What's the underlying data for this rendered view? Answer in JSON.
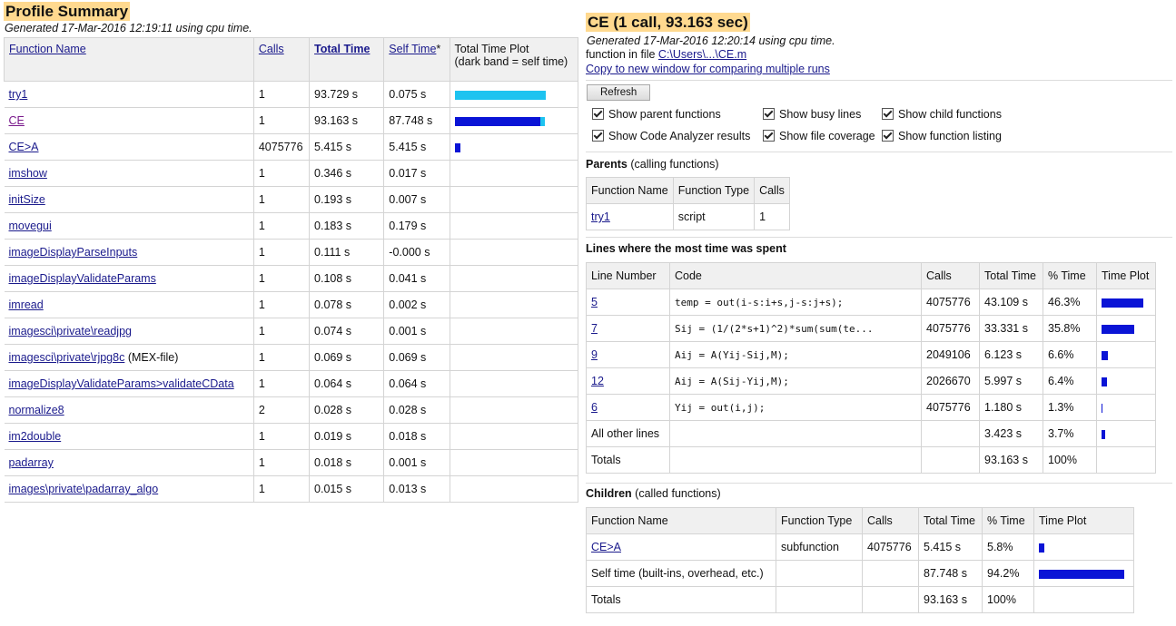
{
  "summary": {
    "title": "Profile Summary",
    "generated": "Generated 17-Mar-2016 12:19:11 using cpu time.",
    "headers": {
      "function_name": "Function Name",
      "calls": "Calls",
      "total_time": "Total Time",
      "self_time": "Self Time",
      "self_time_mark": "*",
      "plot_line1": "Total Time Plot",
      "plot_line2": "(dark band = self time)"
    },
    "rows": [
      {
        "name": "try1",
        "suffix": "",
        "calls": "1",
        "total": "93.729 s",
        "self": "0.075 s",
        "total_frac": 1.0,
        "self_frac": 0.0008
      },
      {
        "name": "CE",
        "suffix": "",
        "calls": "1",
        "total": "93.163 s",
        "self": "87.748 s",
        "total_frac": 0.994,
        "self_frac": 0.936
      },
      {
        "name": "CE>A",
        "suffix": "",
        "calls": "4075776",
        "total": "5.415 s",
        "self": "5.415 s",
        "total_frac": 0.058,
        "self_frac": 0.058
      },
      {
        "name": "imshow",
        "suffix": "",
        "calls": "1",
        "total": "0.346 s",
        "self": "0.017 s",
        "total_frac": 0.0037,
        "self_frac": 0.0002
      },
      {
        "name": "initSize",
        "suffix": "",
        "calls": "1",
        "total": "0.193 s",
        "self": "0.007 s",
        "total_frac": 0.0021,
        "self_frac": 0.0001
      },
      {
        "name": "movegui",
        "suffix": "",
        "calls": "1",
        "total": "0.183 s",
        "self": "0.179 s",
        "total_frac": 0.002,
        "self_frac": 0.0019
      },
      {
        "name": "imageDisplayParseInputs",
        "suffix": "",
        "calls": "1",
        "total": "0.111 s",
        "self": "-0.000 s",
        "total_frac": 0.0012,
        "self_frac": 0
      },
      {
        "name": "imageDisplayValidateParams",
        "suffix": "",
        "calls": "1",
        "total": "0.108 s",
        "self": "0.041 s",
        "total_frac": 0.0012,
        "self_frac": 0.0004
      },
      {
        "name": "imread",
        "suffix": "",
        "calls": "1",
        "total": "0.078 s",
        "self": "0.002 s",
        "total_frac": 0.0008,
        "self_frac": 0
      },
      {
        "name": "imagesci\\private\\readjpg",
        "suffix": "",
        "calls": "1",
        "total": "0.074 s",
        "self": "0.001 s",
        "total_frac": 0.0008,
        "self_frac": 0
      },
      {
        "name": "imagesci\\private\\rjpg8c",
        "suffix": " (MEX-file)",
        "calls": "1",
        "total": "0.069 s",
        "self": "0.069 s",
        "total_frac": 0.0007,
        "self_frac": 0.0007
      },
      {
        "name": "imageDisplayValidateParams>validateCData",
        "suffix": "",
        "calls": "1",
        "total": "0.064 s",
        "self": "0.064 s",
        "total_frac": 0.0007,
        "self_frac": 0.0007
      },
      {
        "name": "normalize8",
        "suffix": "",
        "calls": "2",
        "total": "0.028 s",
        "self": "0.028 s",
        "total_frac": 0.0003,
        "self_frac": 0.0003
      },
      {
        "name": "im2double",
        "suffix": "",
        "calls": "1",
        "total": "0.019 s",
        "self": "0.018 s",
        "total_frac": 0.0002,
        "self_frac": 0.0002
      },
      {
        "name": "padarray",
        "suffix": "",
        "calls": "1",
        "total": "0.018 s",
        "self": "0.001 s",
        "total_frac": 0.0002,
        "self_frac": 0
      },
      {
        "name": "images\\private\\padarray_algo",
        "suffix": "",
        "calls": "1",
        "total": "0.015 s",
        "self": "0.013 s",
        "total_frac": 0.0002,
        "self_frac": 0.0001
      }
    ]
  },
  "detail": {
    "title": "CE (1 call, 93.163 sec)",
    "generated": "Generated 17-Mar-2016 12:20:14 using cpu time.",
    "file_prefix": "function in file ",
    "file_path": "C:\\Users\\...\\CE.m",
    "copy_link": "Copy to new window for comparing multiple runs",
    "refresh_label": "Refresh",
    "options": [
      {
        "label": "Show parent functions",
        "checked": true
      },
      {
        "label": "Show busy lines",
        "checked": true
      },
      {
        "label": "Show child functions",
        "checked": true
      },
      {
        "label": "Show Code Analyzer results",
        "checked": true
      },
      {
        "label": "Show file coverage",
        "checked": true
      },
      {
        "label": "Show function listing",
        "checked": true
      }
    ],
    "parents": {
      "heading_bold": "Parents",
      "heading_rest": " (calling functions)",
      "headers": [
        "Function Name",
        "Function Type",
        "Calls"
      ],
      "rows": [
        {
          "name": "try1",
          "type": "script",
          "calls": "1"
        }
      ]
    },
    "lines": {
      "heading": "Lines where the most time was spent",
      "headers": [
        "Line Number",
        "Code",
        "Calls",
        "Total Time",
        "% Time",
        "Time Plot"
      ],
      "rows": [
        {
          "line": "5",
          "code": "temp = out(i-s:i+s,j-s:j+s);",
          "calls": "4075776",
          "total": "43.109 s",
          "pct": "46.3%",
          "frac": 0.463
        },
        {
          "line": "7",
          "code": "Sij = (1/(2*s+1)^2)*sum(sum(te...",
          "calls": "4075776",
          "total": "33.331 s",
          "pct": "35.8%",
          "frac": 0.358
        },
        {
          "line": "9",
          "code": "Aij = A(Yij-Sij,M);",
          "calls": "2049106",
          "total": "6.123 s",
          "pct": "6.6%",
          "frac": 0.066
        },
        {
          "line": "12",
          "code": "Aij = A(Sij-Yij,M);",
          "calls": "2026670",
          "total": "5.997 s",
          "pct": "6.4%",
          "frac": 0.064
        },
        {
          "line": "6",
          "code": "Yij = out(i,j);",
          "calls": "4075776",
          "total": "1.180 s",
          "pct": "1.3%",
          "frac": 0.013
        },
        {
          "line": "",
          "code": "",
          "label": "All other lines",
          "calls": "",
          "total": "3.423 s",
          "pct": "3.7%",
          "frac": 0.037
        }
      ],
      "totals": {
        "label": "Totals",
        "total": "93.163 s",
        "pct": "100%"
      }
    },
    "children": {
      "heading_bold": "Children",
      "heading_rest": " (called functions)",
      "headers": [
        "Function Name",
        "Function Type",
        "Calls",
        "Total Time",
        "% Time",
        "Time Plot"
      ],
      "rows": [
        {
          "name": "CE>A",
          "link": true,
          "type": "subfunction",
          "calls": "4075776",
          "total": "5.415 s",
          "pct": "5.8%",
          "frac": 0.058
        },
        {
          "name": "Self time (built-ins, overhead, etc.)",
          "link": false,
          "type": "",
          "calls": "",
          "total": "87.748 s",
          "pct": "94.2%",
          "frac": 0.942
        }
      ],
      "totals": {
        "label": "Totals",
        "total": "93.163 s",
        "pct": "100%"
      }
    },
    "colors": {
      "bar_dark": "#0a14d6",
      "bar_light": "#1ec3f0"
    }
  }
}
